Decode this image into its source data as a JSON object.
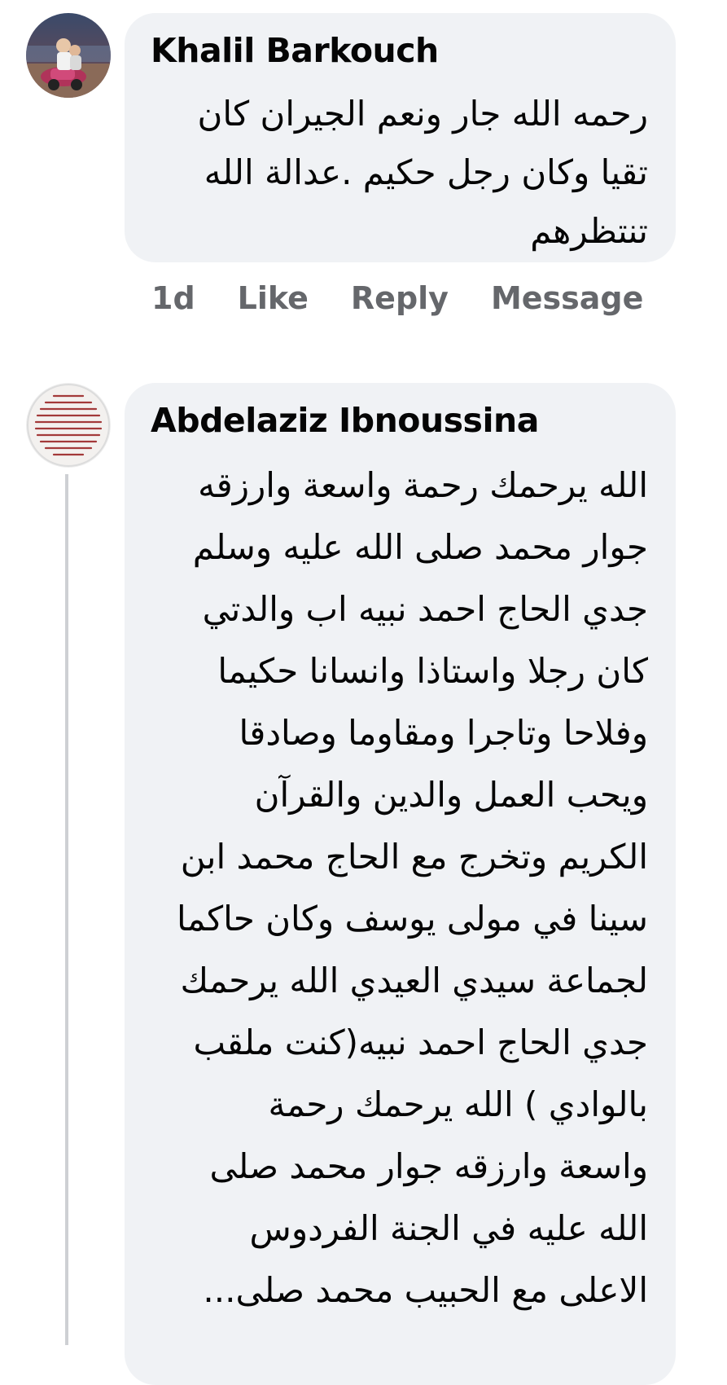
{
  "comments": [
    {
      "author": "Khalil Barkouch",
      "text": "رحمه الله جار ونعم الجيران كان\nتقيا وكان رجل حكيم .عدالة الله\nتنتظرهم",
      "time": "1d",
      "like_label": "Like",
      "reply_label": "Reply",
      "message_label": "Message",
      "avatar_icon": "avatar-child-photo-icon"
    },
    {
      "author": "Abdelaziz Ibnoussina",
      "text": "الله يرحمك رحمة واسعة وارزقه\nجوار محمد صلى الله عليه وسلم\nجدي الحاج احمد نبيه اب والدتي\nكان رجلا واستاذا وانسانا حكيما\nوفلاحا وتاجرا ومقاوما وصادقا\nويحب العمل والدين والقرآن\nالكريم وتخرج مع الحاج محمد ابن\nسينا في مولى يوسف وكان حاكما\nلجماعة سيدي العيدي الله يرحمك\nجدي الحاج احمد نبيه(كنت ملقب\nبالوادي )  الله يرحمك رحمة\nواسعة وارزقه جوار محمد صلى\nالله عليه في الجنة الفردوس\nالاعلى مع الحبيب محمد صلى...",
      "avatar_icon": "avatar-text-card-icon"
    }
  ],
  "colors": {
    "bubble_bg": "#f0f2f5",
    "text": "#050505",
    "secondary_text": "#65676b",
    "thread_line": "#ced0d4"
  }
}
